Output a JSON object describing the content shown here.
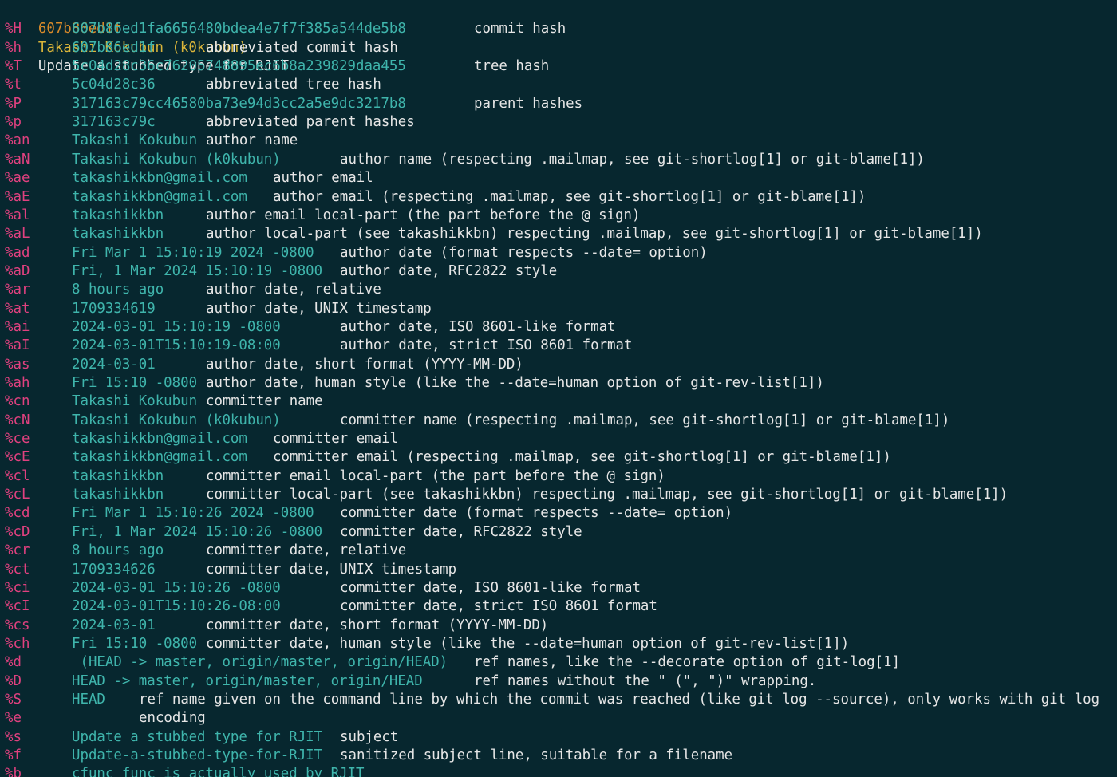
{
  "window": {
    "background": "#07272f",
    "placeholder_color": "#e0417f",
    "value_color": "#3fb5ac",
    "hash_color": "#d98a2a",
    "author_color": "#d9b43a",
    "text_color": "#e6e6e6"
  },
  "header": {
    "hash": "607b86ed1f",
    "author": "Takashi Kokubun (k0kubun)",
    "subject": "Update a stubbed type for RJIT"
  },
  "rows": [
    {
      "ph": "%H",
      "value": "607b86ed1fa6656480bdea4e7f7f385a544de5b8",
      "desc": "commit hash"
    },
    {
      "ph": "%h",
      "value": "607b86ed1f",
      "desc": "abbreviated commit hash"
    },
    {
      "ph": "%T",
      "value": "5c04d28c36c76205748895ec6b8a239829daa455",
      "desc": "tree hash"
    },
    {
      "ph": "%t",
      "value": "5c04d28c36",
      "desc": "abbreviated tree hash"
    },
    {
      "ph": "%P",
      "value": "317163c79cc46580ba73e94d3cc2a5e9dc3217b8",
      "desc": "parent hashes"
    },
    {
      "ph": "%p",
      "value": "317163c79c",
      "desc": "abbreviated parent hashes"
    },
    {
      "ph": "%an",
      "value": "Takashi Kokubun",
      "desc": "author name"
    },
    {
      "ph": "%aN",
      "value": "Takashi Kokubun (k0kubun)",
      "desc": "author name (respecting .mailmap, see git-shortlog[1] or git-blame[1])"
    },
    {
      "ph": "%ae",
      "value": "takashikkbn@gmail.com",
      "desc": "author email"
    },
    {
      "ph": "%aE",
      "value": "takashikkbn@gmail.com",
      "desc": "author email (respecting .mailmap, see git-shortlog[1] or git-blame[1])"
    },
    {
      "ph": "%al",
      "value": "takashikkbn",
      "desc": "author email local-part (the part before the @ sign)"
    },
    {
      "ph": "%aL",
      "value": "takashikkbn",
      "desc": "author local-part (see takashikkbn) respecting .mailmap, see git-shortlog[1] or git-blame[1])"
    },
    {
      "ph": "%ad",
      "value": "Fri Mar 1 15:10:19 2024 -0800",
      "desc": "author date (format respects --date= option)"
    },
    {
      "ph": "%aD",
      "value": "Fri, 1 Mar 2024 15:10:19 -0800",
      "desc": "author date, RFC2822 style"
    },
    {
      "ph": "%ar",
      "value": "8 hours ago",
      "desc": "author date, relative"
    },
    {
      "ph": "%at",
      "value": "1709334619",
      "desc": "author date, UNIX timestamp"
    },
    {
      "ph": "%ai",
      "value": "2024-03-01 15:10:19 -0800",
      "desc": "author date, ISO 8601-like format"
    },
    {
      "ph": "%aI",
      "value": "2024-03-01T15:10:19-08:00",
      "desc": "author date, strict ISO 8601 format"
    },
    {
      "ph": "%as",
      "value": "2024-03-01",
      "desc": "author date, short format (YYYY-MM-DD)"
    },
    {
      "ph": "%ah",
      "value": "Fri 15:10 -0800",
      "desc": "author date, human style (like the --date=human option of git-rev-list[1])"
    },
    {
      "ph": "%cn",
      "value": "Takashi Kokubun",
      "desc": "committer name"
    },
    {
      "ph": "%cN",
      "value": "Takashi Kokubun (k0kubun)",
      "desc": "committer name (respecting .mailmap, see git-shortlog[1] or git-blame[1])"
    },
    {
      "ph": "%ce",
      "value": "takashikkbn@gmail.com",
      "desc": "committer email"
    },
    {
      "ph": "%cE",
      "value": "takashikkbn@gmail.com",
      "desc": "committer email (respecting .mailmap, see git-shortlog[1] or git-blame[1])"
    },
    {
      "ph": "%cl",
      "value": "takashikkbn",
      "desc": "committer email local-part (the part before the @ sign)"
    },
    {
      "ph": "%cL",
      "value": "takashikkbn",
      "desc": "committer local-part (see takashikkbn) respecting .mailmap, see git-shortlog[1] or git-blame[1])"
    },
    {
      "ph": "%cd",
      "value": "Fri Mar 1 15:10:26 2024 -0800",
      "desc": "committer date (format respects --date= option)"
    },
    {
      "ph": "%cD",
      "value": "Fri, 1 Mar 2024 15:10:26 -0800",
      "desc": "committer date, RFC2822 style"
    },
    {
      "ph": "%cr",
      "value": "8 hours ago",
      "desc": "committer date, relative"
    },
    {
      "ph": "%ct",
      "value": "1709334626",
      "desc": "committer date, UNIX timestamp"
    },
    {
      "ph": "%ci",
      "value": "2024-03-01 15:10:26 -0800",
      "desc": "committer date, ISO 8601-like format"
    },
    {
      "ph": "%cI",
      "value": "2024-03-01T15:10:26-08:00",
      "desc": "committer date, strict ISO 8601 format"
    },
    {
      "ph": "%cs",
      "value": "2024-03-01",
      "desc": "committer date, short format (YYYY-MM-DD)"
    },
    {
      "ph": "%ch",
      "value": "Fri 15:10 -0800",
      "desc": "committer date, human style (like the --date=human option of git-rev-list[1])"
    },
    {
      "ph": "%d",
      "value": " (HEAD -> master, origin/master, origin/HEAD)",
      "desc": "ref names, like the --decorate option of git-log[1]"
    },
    {
      "ph": "%D",
      "value": "HEAD -> master, origin/master, origin/HEAD",
      "desc": "ref names without the \" (\", \")\" wrapping."
    },
    {
      "ph": "%S",
      "value": "HEAD",
      "desc": "ref name given on the command line by which the commit was reached (like git log --source), only works with git log"
    },
    {
      "ph": "%e",
      "value": "",
      "desc": "encoding"
    },
    {
      "ph": "%s",
      "value": "Update a stubbed type for RJIT",
      "desc": "subject"
    },
    {
      "ph": "%f",
      "value": "Update-a-stubbed-type-for-RJIT",
      "desc": "sanitized subject line, suitable for a filename"
    },
    {
      "ph": "%b",
      "value": "cfunc func is actually used by RJIT",
      "desc": ""
    }
  ]
}
